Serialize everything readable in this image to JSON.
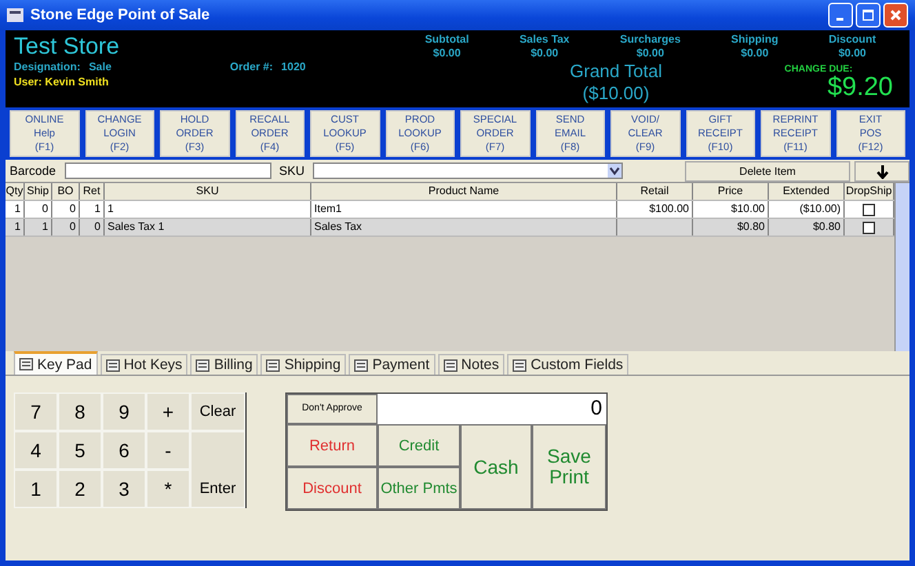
{
  "window": {
    "title": "Stone Edge Point of Sale"
  },
  "header": {
    "store": "Test Store",
    "designation_label": "Designation:",
    "designation": "Sale",
    "order_label": "Order #:",
    "order": "1020",
    "user": "User: Kevin Smith",
    "totals": [
      {
        "label": "Subtotal",
        "value": "$0.00"
      },
      {
        "label": "Sales Tax",
        "value": "$0.00"
      },
      {
        "label": "Surcharges",
        "value": "$0.00"
      },
      {
        "label": "Shipping",
        "value": "$0.00"
      },
      {
        "label": "Discount",
        "value": "$0.00"
      }
    ],
    "grand_total_label": "Grand Total",
    "grand_total": "($10.00)",
    "change_due_label": "CHANGE DUE:",
    "change_due": "$9.20"
  },
  "function_buttons": [
    [
      "ONLINE",
      "Help",
      "(F1)"
    ],
    [
      "CHANGE",
      "LOGIN",
      "(F2)"
    ],
    [
      "HOLD",
      "ORDER",
      "(F3)"
    ],
    [
      "RECALL",
      "ORDER",
      "(F4)"
    ],
    [
      "CUST",
      "LOOKUP",
      "(F5)"
    ],
    [
      "PROD",
      "LOOKUP",
      "(F6)"
    ],
    [
      "SPECIAL",
      "ORDER",
      "(F7)"
    ],
    [
      "SEND",
      "EMAIL",
      "(F8)"
    ],
    [
      "VOID/",
      "CLEAR",
      "(F9)"
    ],
    [
      "GIFT",
      "RECEIPT",
      "(F10)"
    ],
    [
      "REPRINT",
      "RECEIPT",
      "(F11)"
    ],
    [
      "EXIT",
      "POS",
      "(F12)"
    ]
  ],
  "entry": {
    "barcode_label": "Barcode",
    "sku_label": "SKU",
    "delete_button": "Delete Item"
  },
  "table": {
    "columns": [
      "Qty",
      "Ship",
      "BO",
      "Ret",
      "SKU",
      "Product Name",
      "Retail",
      "Price",
      "Extended",
      "DropShip"
    ],
    "rows": [
      {
        "cells": [
          "1",
          "0",
          "0",
          "1",
          "1",
          "Item1",
          "$100.00",
          "$10.00",
          "($10.00)"
        ],
        "dropship": false,
        "selected": false
      },
      {
        "cells": [
          "1",
          "1",
          "0",
          "0",
          "Sales Tax 1",
          "Sales Tax",
          "",
          "$0.80",
          "$0.80"
        ],
        "dropship": false,
        "selected": true
      }
    ]
  },
  "tabs": [
    {
      "label": "Key Pad",
      "selected": true
    },
    {
      "label": "Hot Keys",
      "selected": false
    },
    {
      "label": "Billing",
      "selected": false
    },
    {
      "label": "Shipping",
      "selected": false
    },
    {
      "label": "Payment",
      "selected": false
    },
    {
      "label": "Notes",
      "selected": false
    },
    {
      "label": "Custom Fields",
      "selected": false
    }
  ],
  "keypad": [
    {
      "label": "7",
      "kind": "digit"
    },
    {
      "label": "8",
      "kind": "digit"
    },
    {
      "label": "9",
      "kind": "digit"
    },
    {
      "label": "+",
      "kind": "digit"
    },
    {
      "label": "Clear",
      "kind": "action"
    },
    {
      "label": "4",
      "kind": "digit"
    },
    {
      "label": "5",
      "kind": "digit"
    },
    {
      "label": "6",
      "kind": "digit"
    },
    {
      "label": "-",
      "kind": "digit"
    },
    {
      "label": "1",
      "kind": "digit"
    },
    {
      "label": "2",
      "kind": "digit"
    },
    {
      "label": "3",
      "kind": "digit"
    },
    {
      "label": "*",
      "kind": "digit"
    },
    {
      "label": "Enter",
      "kind": "tall"
    }
  ],
  "payment": {
    "dont_approve": "Don't Approve",
    "amount": "0",
    "buttons": [
      {
        "label": "Return",
        "kind": "negative"
      },
      {
        "label": "Credit",
        "kind": "positive"
      },
      {
        "label": "Cash",
        "kind": "large"
      },
      {
        "label": "Save Print",
        "kind": "large"
      },
      {
        "label": "Discount",
        "kind": "negative"
      },
      {
        "label": "Other Pmts",
        "kind": "positive"
      }
    ]
  }
}
